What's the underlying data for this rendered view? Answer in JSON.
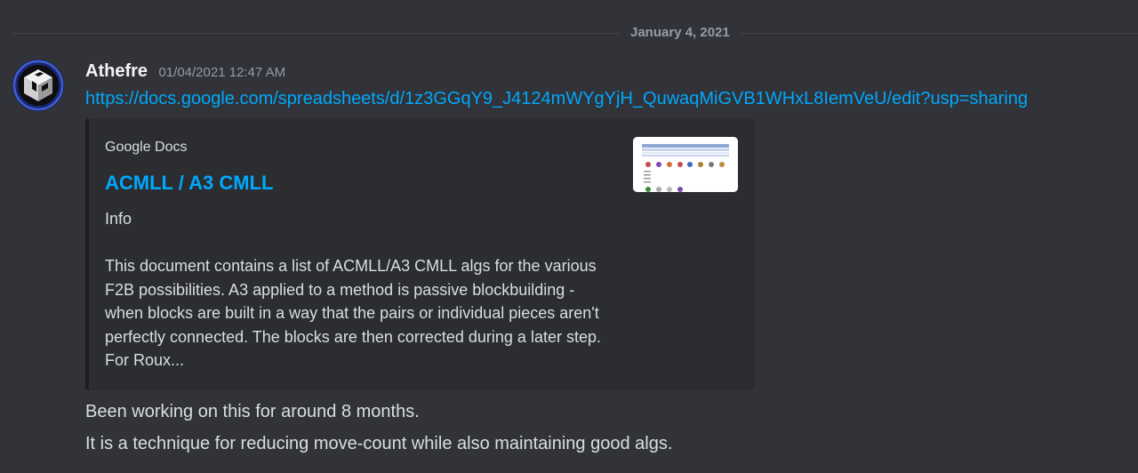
{
  "divider": {
    "date": "January 4, 2021"
  },
  "message": {
    "author": "Athefre",
    "timestamp": "01/04/2021 12:47 AM",
    "link": "https://docs.google.com/spreadsheets/d/1z3GGqY9_J4124mWYgYjH_QuwaqMiGVB1WHxL8IemVeU/edit?usp=sharing",
    "avatar_icon": "cube-logo-icon",
    "embed": {
      "provider": "Google Docs",
      "title": "ACMLL / A3 CMLL",
      "heading": "Info",
      "description": "This document contains a list of ACMLL/A3 CMLL algs for the various F2B possibilities. A3 applied to a method is passive blockbuilding - when blocks are built in a way that the pairs or individual pieces aren't perfectly connected. The blocks are then corrected during a later step. For Roux...",
      "thumbnail_icon": "spreadsheet-thumbnail"
    },
    "lines": [
      "Been working on this for around 8 months.",
      "It is a technique for reducing move-count while also maintaining good algs."
    ]
  },
  "colors": {
    "background": "#313338",
    "link": "#00a8fc",
    "embed_bg": "#2b2d31",
    "muted": "#949ba4"
  }
}
